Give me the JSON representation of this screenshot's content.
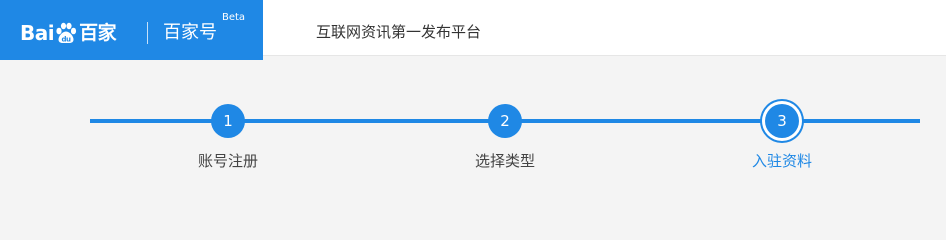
{
  "header": {
    "logo_text_bai": "Bai",
    "logo_text_du": "du",
    "logo_text_baijia": "百家",
    "product_name": "百家号",
    "beta_badge": "Beta",
    "slogan": "互联网资讯第一发布平台"
  },
  "steps": [
    {
      "number": "1",
      "label": "账号注册",
      "state": "completed"
    },
    {
      "number": "2",
      "label": "选择类型",
      "state": "completed"
    },
    {
      "number": "3",
      "label": "入驻资料",
      "state": "current"
    }
  ],
  "colors": {
    "brand_blue": "#1f88e5",
    "page_background": "#f4f4f4",
    "header_background": "#ffffff",
    "label_text": "#444444"
  }
}
